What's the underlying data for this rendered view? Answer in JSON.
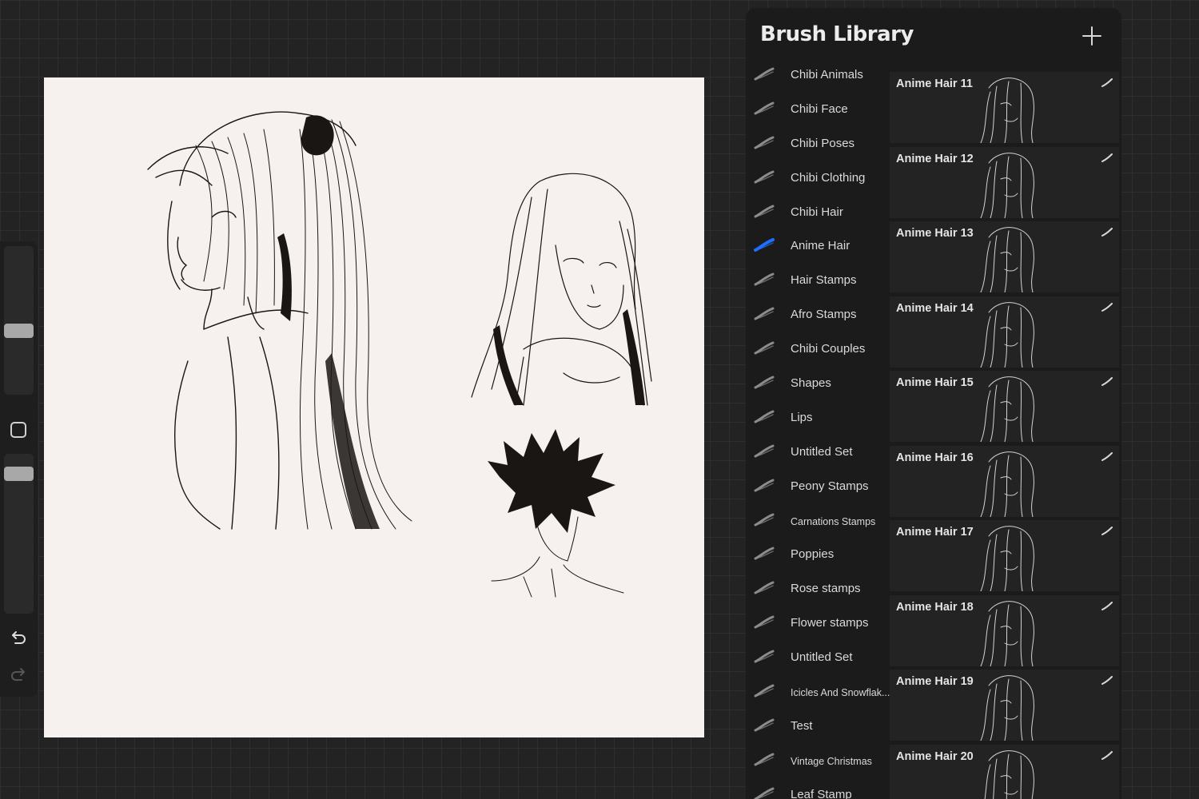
{
  "panel": {
    "title": "Brush Library",
    "add_icon": "plus-icon",
    "accent_color": "#1f6fff"
  },
  "sets": [
    {
      "label": "Chibi Animals",
      "selected": false
    },
    {
      "label": "Chibi Face",
      "selected": false
    },
    {
      "label": "Chibi Poses",
      "selected": false
    },
    {
      "label": "Chibi Clothing",
      "selected": false
    },
    {
      "label": "Chibi Hair",
      "selected": false
    },
    {
      "label": "Anime Hair",
      "selected": true
    },
    {
      "label": "Hair Stamps",
      "selected": false
    },
    {
      "label": "Afro Stamps",
      "selected": false
    },
    {
      "label": "Chibi Couples",
      "selected": false
    },
    {
      "label": "Shapes",
      "selected": false
    },
    {
      "label": "Lips",
      "selected": false
    },
    {
      "label": "Untitled Set",
      "selected": false
    },
    {
      "label": "Peony Stamps",
      "selected": false
    },
    {
      "label": "Carnations Stamps",
      "selected": false
    },
    {
      "label": "Poppies",
      "selected": false
    },
    {
      "label": "Rose stamps",
      "selected": false
    },
    {
      "label": "Flower stamps",
      "selected": false
    },
    {
      "label": "Untitled Set",
      "selected": false
    },
    {
      "label": "Icicles And Snowflak...",
      "selected": false
    },
    {
      "label": "Test",
      "selected": false
    },
    {
      "label": "Vintage Christmas",
      "selected": false
    },
    {
      "label": "Leaf Stamp",
      "selected": false
    }
  ],
  "brushes": [
    {
      "name": "Anime Hair 11"
    },
    {
      "name": "Anime Hair 12"
    },
    {
      "name": "Anime Hair 13"
    },
    {
      "name": "Anime Hair 14"
    },
    {
      "name": "Anime Hair 15"
    },
    {
      "name": "Anime Hair 16"
    },
    {
      "name": "Anime Hair 17"
    },
    {
      "name": "Anime Hair 18"
    },
    {
      "name": "Anime Hair 19"
    },
    {
      "name": "Anime Hair 20"
    }
  ],
  "sidebar": {
    "size_slider_value": 0.48,
    "opacity_slider_value": 0.18,
    "undo_icon": "undo-icon",
    "redo_icon": "redo-icon",
    "modify_icon": "square-icon"
  }
}
